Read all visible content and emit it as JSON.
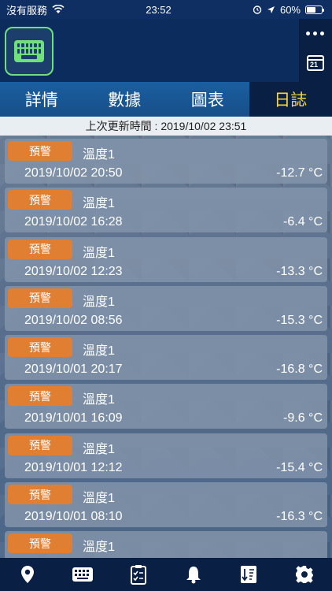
{
  "status_bar": {
    "carrier": "沒有服務",
    "time": "23:52",
    "battery": "60%",
    "battery_level": 0.6
  },
  "header": {
    "app_icon": "keyboard-icon",
    "more": "more-icon",
    "calendar": "calendar-search-icon",
    "calendar_label": "21"
  },
  "tabs": [
    {
      "label": "詳情",
      "active": false
    },
    {
      "label": "數據",
      "active": false
    },
    {
      "label": "圖表",
      "active": false
    },
    {
      "label": "日誌",
      "active": true
    }
  ],
  "update": {
    "text": "上次更新時間 : 2019/10/02 23:51"
  },
  "log_items": [
    {
      "badge": "預警",
      "type": "溫度1",
      "time": "2019/10/02 20:50",
      "value": "-12.7 °C"
    },
    {
      "badge": "預警",
      "type": "溫度1",
      "time": "2019/10/02 16:28",
      "value": "-6.4 °C"
    },
    {
      "badge": "預警",
      "type": "溫度1",
      "time": "2019/10/02 12:23",
      "value": "-13.3 °C"
    },
    {
      "badge": "預警",
      "type": "溫度1",
      "time": "2019/10/02 08:56",
      "value": "-15.3 °C"
    },
    {
      "badge": "預警",
      "type": "溫度1",
      "time": "2019/10/01 20:17",
      "value": "-16.8 °C"
    },
    {
      "badge": "預警",
      "type": "溫度1",
      "time": "2019/10/01 16:09",
      "value": "-9.6 °C"
    },
    {
      "badge": "預警",
      "type": "溫度1",
      "time": "2019/10/01 12:12",
      "value": "-15.4 °C"
    },
    {
      "badge": "預警",
      "type": "溫度1",
      "time": "2019/10/01 08:10",
      "value": "-16.3 °C"
    },
    {
      "badge": "預警",
      "type": "溫度1",
      "time": "",
      "value": ""
    }
  ],
  "bottom_nav": [
    {
      "name": "location-pin-icon"
    },
    {
      "name": "keyboard-icon"
    },
    {
      "name": "clipboard-checklist-icon"
    },
    {
      "name": "bell-icon"
    },
    {
      "name": "sort-list-icon"
    },
    {
      "name": "gear-icon"
    }
  ],
  "colors": {
    "badge": "#e07f32",
    "active_tab": "#f7d54a",
    "accent_green": "#6fe07a"
  }
}
